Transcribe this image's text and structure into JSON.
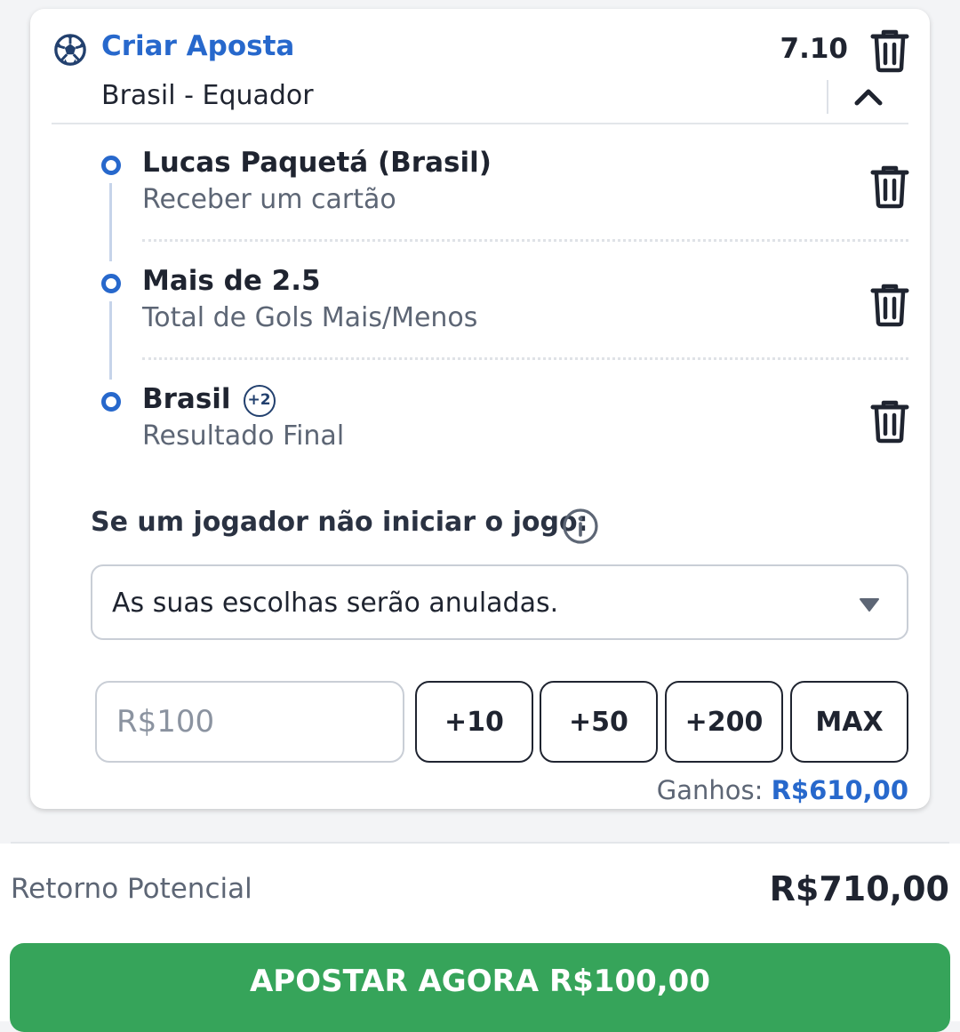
{
  "header": {
    "title": "Criar Aposta",
    "odds": "7.10",
    "match": "Brasil - Equador",
    "icons": {
      "sport": "soccer-ball-icon",
      "delete": "trash-icon",
      "collapse": "chevron-up-icon"
    }
  },
  "selections": [
    {
      "title": "Lucas Paquetá (Brasil)",
      "subtitle": "Receber um cartão"
    },
    {
      "title": "Mais de 2.5",
      "subtitle": "Total de Gols Mais/Menos"
    },
    {
      "title": "Brasil",
      "badge": "+2",
      "subtitle": "Resultado Final"
    }
  ],
  "player_rule": {
    "label": "Se um jogador não iniciar o jogo:",
    "selected": "As suas escolhas serão anuladas."
  },
  "stake": {
    "placeholder": "R$100",
    "quick_buttons": [
      "+10",
      "+50",
      "+200",
      "MAX"
    ],
    "gains_label": "Ganhos:",
    "gains_value": "R$610,00"
  },
  "footer": {
    "return_label": "Retorno Potencial",
    "return_value": "R$710,00",
    "bet_button": "APOSTAR AGORA R$100,00"
  },
  "colors": {
    "accent": "#2768cc",
    "cta": "#36a45a",
    "text": "#1f2430",
    "muted": "#5d6675"
  }
}
